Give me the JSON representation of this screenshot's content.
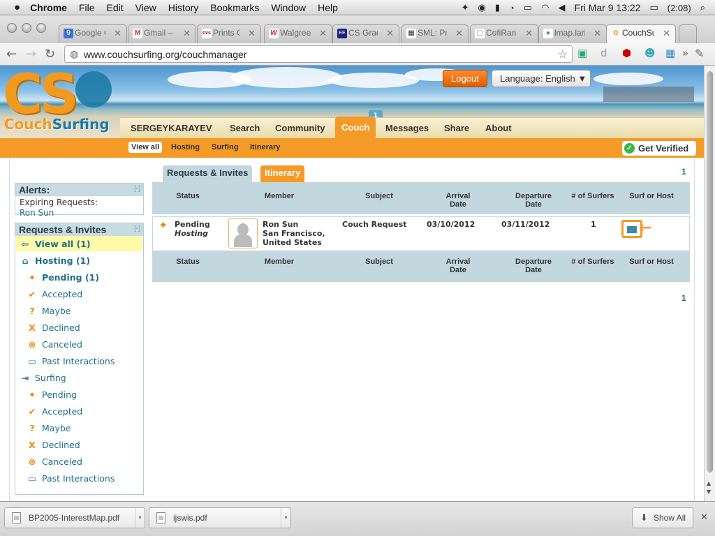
{
  "menubar": {
    "app": "Chrome",
    "items": [
      "File",
      "Edit",
      "View",
      "History",
      "Bookmarks",
      "Window",
      "Help"
    ],
    "clock": "Fri Mar 9  13:22",
    "battery": "(2:08)"
  },
  "tabs": [
    {
      "title": "Google C",
      "fav": "9",
      "color": "#3b73d6"
    },
    {
      "title": "Gmail – I",
      "fav": "M",
      "color": "#d93025"
    },
    {
      "title": "Prints Co",
      "fav": "cvs",
      "color": "#cc0000"
    },
    {
      "title": "Walgreen",
      "fav": "W",
      "color": "#e31837"
    },
    {
      "title": "CS Gradu",
      "fav": "EE",
      "color": "#1a237e"
    },
    {
      "title": "SML: Proj",
      "fav": "▦",
      "color": "#333"
    },
    {
      "title": "CofiRank",
      "fav": "▢",
      "color": "#8a7fd0"
    },
    {
      "title": "lmap.lari",
      "fav": "●",
      "color": "#34a853"
    },
    {
      "title": "CouchSurf",
      "fav": "✿",
      "color": "#f49a27"
    }
  ],
  "toolbar": {
    "url": "www.couchsurfing.org/couchmanager"
  },
  "header": {
    "logo_letters": "CS",
    "logo_couch": "Couch",
    "logo_surfing": "Surfing",
    "logout": "Logout",
    "language": "Language: English ▼"
  },
  "mainnav": {
    "items": [
      "SERGEYKARAYEV",
      "Search",
      "Community",
      "Couch",
      "Messages",
      "Share",
      "About"
    ],
    "badge": "1"
  },
  "subnav": {
    "items": [
      "View all",
      "Hosting",
      "Surfing",
      "Itinerary"
    ],
    "verified": "Get Verified"
  },
  "sidebar": {
    "alerts_title": "Alerts:",
    "collapse": "[-]",
    "expiring_label": "Expiring Requests:",
    "expiring_name": "Ron Sun",
    "ri_title": "Requests & Invites",
    "items": [
      {
        "label": "View all (1)",
        "icon": "house-arrow-icon"
      },
      {
        "label": "Hosting (1)",
        "icon": "house-arrow-icon"
      },
      {
        "label": "Pending (1)",
        "icon": "sparkle-icon"
      },
      {
        "label": "Accepted",
        "icon": "check-icon"
      },
      {
        "label": "Maybe",
        "icon": "question-icon"
      },
      {
        "label": "Declined",
        "icon": "x-icon"
      },
      {
        "label": "Canceled",
        "icon": "circle-x-icon"
      },
      {
        "label": "Past Interactions",
        "icon": "folder-icon"
      },
      {
        "label": "Surfing",
        "icon": "surfer-icon"
      },
      {
        "label": "Pending",
        "icon": "sparkle-icon"
      },
      {
        "label": "Accepted",
        "icon": "check-icon"
      },
      {
        "label": "Maybe",
        "icon": "question-icon"
      },
      {
        "label": "Declined",
        "icon": "x-icon"
      },
      {
        "label": "Canceled",
        "icon": "circle-x-icon"
      },
      {
        "label": "Past Interactions",
        "icon": "folder-icon"
      }
    ]
  },
  "main": {
    "tab1": "Requests & Invites",
    "tab2": "Itinerary",
    "page_num": "1",
    "columns": [
      "Status",
      "Member",
      "Subject",
      "Arrival Date",
      "Departure Date",
      "# of Surfers",
      "Surf or Host"
    ],
    "row": {
      "status": "Pending",
      "status_type": "Hosting",
      "member_name": "Ron Sun",
      "member_city": "San Francisco,",
      "member_country": "United States",
      "subject": "Couch Request",
      "arrival": "03/10/2012",
      "departure": "03/11/2012",
      "surfers": "1"
    }
  },
  "downloads": {
    "files": [
      "BP2005-InterestMap.pdf",
      "ijswis.pdf"
    ],
    "show_all": "Show All"
  }
}
